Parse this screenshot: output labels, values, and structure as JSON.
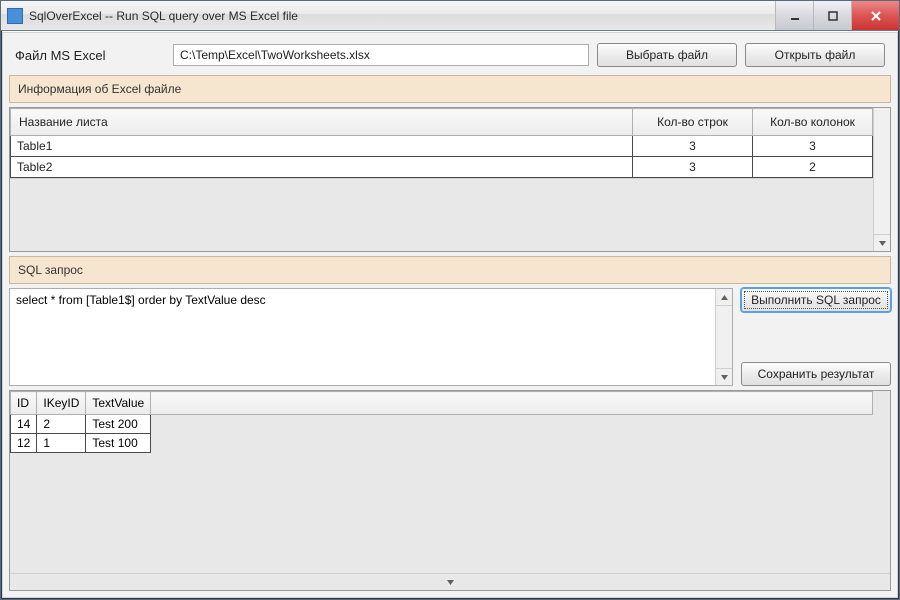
{
  "window": {
    "title": "SqlOverExcel -- Run SQL query over MS Excel file"
  },
  "file_row": {
    "label": "Файл MS Excel",
    "path": "C:\\Temp\\Excel\\TwoWorksheets.xlsx",
    "choose_btn": "Выбрать файл",
    "open_btn": "Открыть файл"
  },
  "info_head": "Информация об Excel файле",
  "sheets_table": {
    "headers": {
      "name": "Название листа",
      "rows": "Кол-во строк",
      "cols": "Кол-во колонок"
    },
    "rows": [
      {
        "name": "Table1",
        "rows": "3",
        "cols": "3"
      },
      {
        "name": "Table2",
        "rows": "3",
        "cols": "2"
      }
    ]
  },
  "sql_head": "SQL запрос",
  "sql_text": "select * from [Table1$] order by TextValue desc",
  "run_btn": "Выполнить SQL запрос",
  "save_btn": "Сохранить результат",
  "result_table": {
    "headers": [
      "ID",
      "IKeyID",
      "TextValue"
    ],
    "rows": [
      [
        "14",
        "2",
        "Test 200"
      ],
      [
        "12",
        "1",
        "Test 100"
      ]
    ]
  }
}
